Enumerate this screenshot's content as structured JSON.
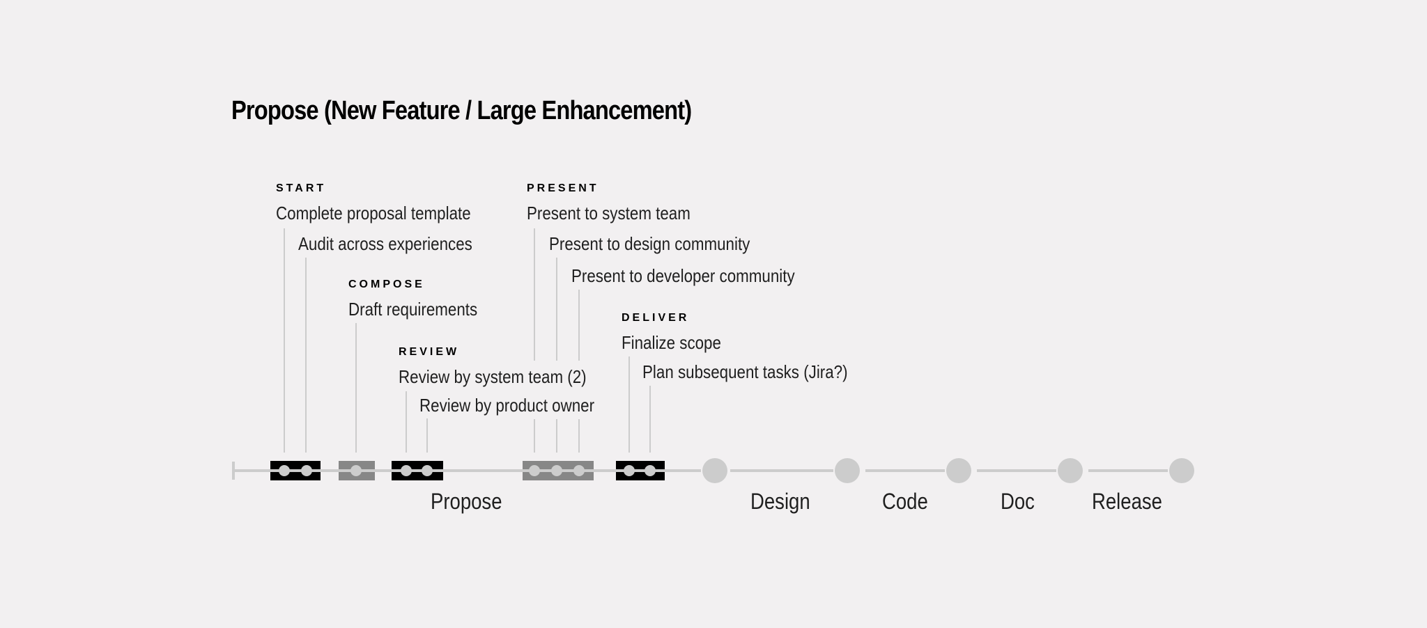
{
  "title": "Propose (New Feature / Large Enhancement)",
  "colors": {
    "background": "#f2f0f1",
    "line": "#cccccc",
    "block_dark": "#000000",
    "block_gray": "#878787",
    "dot": "#cccccc",
    "text": "#1f1f1f"
  },
  "phases": [
    {
      "name": "START",
      "style": "dark",
      "tasks": [
        "Complete proposal template",
        "Audit across experiences"
      ]
    },
    {
      "name": "COMPOSE",
      "style": "gray",
      "tasks": [
        "Draft requirements"
      ]
    },
    {
      "name": "REVIEW",
      "style": "dark",
      "tasks": [
        "Review by system team (2)",
        "Review by product owner"
      ]
    },
    {
      "name": "PRESENT",
      "style": "gray",
      "tasks": [
        "Present to system team",
        "Present to design community",
        "Present to developer community"
      ]
    },
    {
      "name": "DELIVER",
      "style": "dark",
      "tasks": [
        "Finalize scope",
        "Plan subsequent tasks (Jira?)"
      ]
    }
  ],
  "stages": [
    "Propose",
    "Design",
    "Code",
    "Doc",
    "Release"
  ]
}
